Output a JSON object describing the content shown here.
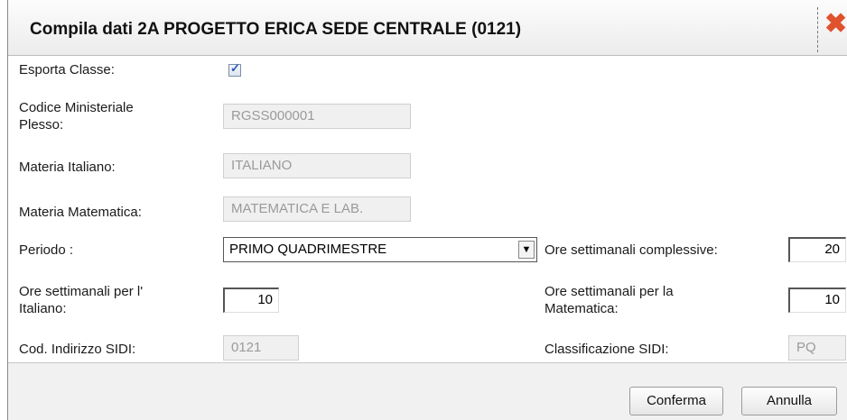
{
  "dialog": {
    "title": "Compila dati 2A PROGETTO ERICA SEDE CENTRALE (0121)",
    "close_icon": "close-icon",
    "close_color": "#e0522e"
  },
  "form": {
    "esporta_label": "Esporta Classe:",
    "esporta_checked": true,
    "codice_label_line1": "Codice Ministeriale",
    "codice_label_line2": "Plesso:",
    "codice_value": "RGSS000001",
    "italiano_label": "Materia Italiano:",
    "italiano_value": "ITALIANO",
    "matematica_label": "Materia Matematica:",
    "matematica_value": "MATEMATICA E LAB.",
    "periodo_label": "Periodo :",
    "periodo_value": "PRIMO QUADRIMESTRE",
    "ore_complessive_label": "Ore settimanali complessive:",
    "ore_complessive_value": "20",
    "ore_italiano_label_line1": "Ore settimanali per l'",
    "ore_italiano_label_line2": "Italiano:",
    "ore_italiano_value": "10",
    "ore_matematica_label_line1": "Ore settimanali per la",
    "ore_matematica_label_line2": "Matematica:",
    "ore_matematica_value": "10",
    "indirizzo_label": "Cod. Indirizzo SIDI:",
    "indirizzo_value": "0121",
    "classificazione_label": "Classificazione SIDI:",
    "classificazione_value": "PQ"
  },
  "footer": {
    "confirm_label": "Conferma",
    "cancel_label": "Annulla"
  }
}
